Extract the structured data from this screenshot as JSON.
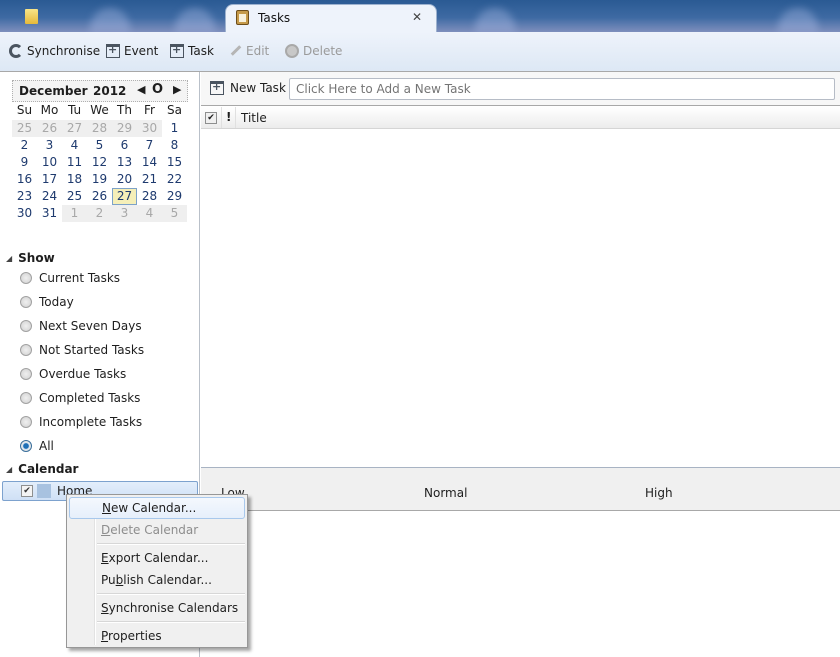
{
  "tabs": [
    {
      "label": "",
      "icon": "folder-icon",
      "active": false
    },
    {
      "label": "Tasks",
      "icon": "tasks-clipboard-icon",
      "active": true,
      "close_glyph": "✕"
    }
  ],
  "toolbar": {
    "synchronise": "Synchronise",
    "event": "Event",
    "task": "Task",
    "edit": "Edit",
    "delete": "Delete"
  },
  "minical": {
    "month": "December",
    "year": "2012",
    "prev_glyph": "◀",
    "today_glyph": "O",
    "next_glyph": "▶",
    "weekdays": [
      "Su",
      "Mo",
      "Tu",
      "We",
      "Th",
      "Fr",
      "Sa"
    ],
    "weeks": [
      [
        "25",
        "26",
        "27",
        "28",
        "29",
        "30",
        "1"
      ],
      [
        "2",
        "3",
        "4",
        "5",
        "6",
        "7",
        "8"
      ],
      [
        "9",
        "10",
        "11",
        "12",
        "13",
        "14",
        "15"
      ],
      [
        "16",
        "17",
        "18",
        "19",
        "20",
        "21",
        "22"
      ],
      [
        "23",
        "24",
        "25",
        "26",
        "27",
        "28",
        "29"
      ],
      [
        "30",
        "31",
        "1",
        "2",
        "3",
        "4",
        "5"
      ]
    ],
    "selected": "27"
  },
  "show": {
    "heading": "Show",
    "options": [
      {
        "label": "Current Tasks",
        "checked": false
      },
      {
        "label": "Today",
        "checked": false
      },
      {
        "label": "Next Seven Days",
        "checked": false
      },
      {
        "label": "Not Started Tasks",
        "checked": false
      },
      {
        "label": "Overdue Tasks",
        "checked": false
      },
      {
        "label": "Completed Tasks",
        "checked": false
      },
      {
        "label": "Incomplete Tasks",
        "checked": false
      },
      {
        "label": "All",
        "checked": true
      }
    ]
  },
  "calendar": {
    "heading": "Calendar",
    "items": [
      {
        "name": "Home",
        "checked": true,
        "color": "#a8c2e0"
      }
    ]
  },
  "newtask": {
    "button": "New Task",
    "placeholder": "Click Here to Add a New Task"
  },
  "list_header": {
    "priority_glyph": "!",
    "title": "Title"
  },
  "priority_bar": {
    "low": "Low",
    "normal": "Normal",
    "high": "High"
  },
  "context_menu": {
    "items": [
      {
        "label": "New Calendar...",
        "accesskey": "N",
        "disabled": false,
        "hover": true
      },
      {
        "label": "Delete Calendar",
        "accesskey": "D",
        "disabled": true
      },
      {
        "label": "Export Calendar...",
        "accesskey": "E",
        "disabled": false
      },
      {
        "label": "Publish Calendar...",
        "accesskey": "b",
        "disabled": false
      },
      {
        "label": "Synchronise Calendars",
        "accesskey": "S",
        "disabled": false
      },
      {
        "label": "Properties",
        "accesskey": "P",
        "disabled": false
      }
    ]
  }
}
